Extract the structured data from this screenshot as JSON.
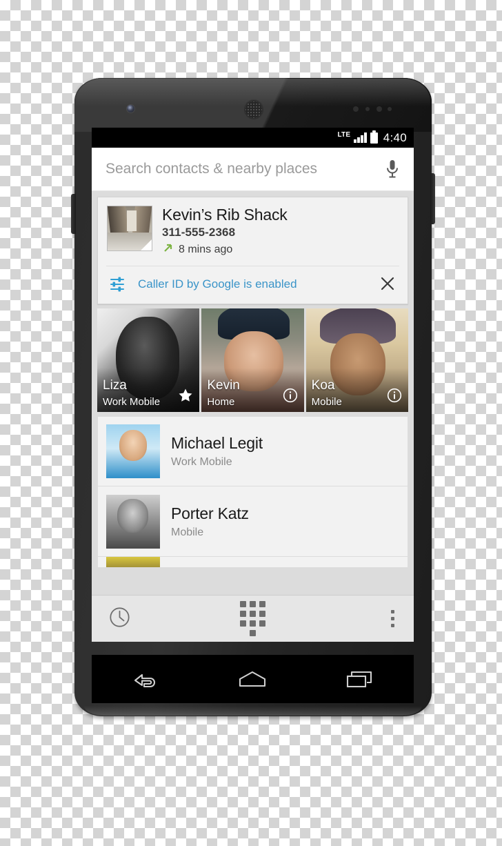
{
  "device": {
    "name": "Android smartphone mockup",
    "front_camera_icon": "front-camera-icon",
    "earpiece_icon": "earpiece-speaker-icon"
  },
  "statusbar": {
    "network": "LTE",
    "signal_icon": "signal-bars-icon",
    "battery_icon": "battery-full-icon",
    "time": "4:40"
  },
  "search": {
    "placeholder": "Search contacts & nearby places",
    "value": "",
    "voice_icon": "microphone-icon"
  },
  "call_card": {
    "thumbnail_icon": "place-photo-thumbnail",
    "name": "Kevin’s Rib Shack",
    "number": "311-555-2368",
    "direction_icon": "outgoing-call-arrow-icon",
    "time_ago": "8 mins ago",
    "caller_id": {
      "icon": "sliders-settings-icon",
      "text": "Caller ID by Google is enabled",
      "text_color": "#3a94c8",
      "icon_color": "#2f9fd4",
      "dismiss_icon": "close-x-icon"
    }
  },
  "favorites": {
    "tiles": [
      {
        "name": "Liza",
        "label": "Work Mobile",
        "badge": "star-icon",
        "photo": "ph-liza"
      },
      {
        "name": "Kevin",
        "label": "Home",
        "badge": "info-icon",
        "photo": "ph-kevin"
      },
      {
        "name": "Koa",
        "label": "Mobile",
        "badge": "info-icon",
        "photo": "ph-koa"
      }
    ]
  },
  "contacts": {
    "rows": [
      {
        "name": "Michael Legit",
        "label": "Work Mobile",
        "avatar": "av-michael"
      },
      {
        "name": "Porter Katz",
        "label": "Mobile",
        "avatar": "av-porter"
      }
    ],
    "partial_row_avatar": "av-third"
  },
  "tabbar": {
    "tabs": [
      {
        "id": "recents",
        "icon": "clock-history-icon"
      },
      {
        "id": "dialpad",
        "icon": "dialpad-icon"
      },
      {
        "id": "overflow",
        "icon": "kebab-menu-icon"
      }
    ]
  },
  "navbar": {
    "buttons": [
      {
        "id": "back",
        "icon": "back-arrow-icon"
      },
      {
        "id": "home",
        "icon": "home-icon"
      },
      {
        "id": "recent",
        "icon": "recent-apps-icon"
      }
    ]
  },
  "colors": {
    "accent_blue": "#3a94c8",
    "call_arrow_green": "#7cb342",
    "screen_bg": "#dcdcdc",
    "card_bg": "#f2f2f2",
    "tabbar_bg": "#e6e6e6"
  }
}
